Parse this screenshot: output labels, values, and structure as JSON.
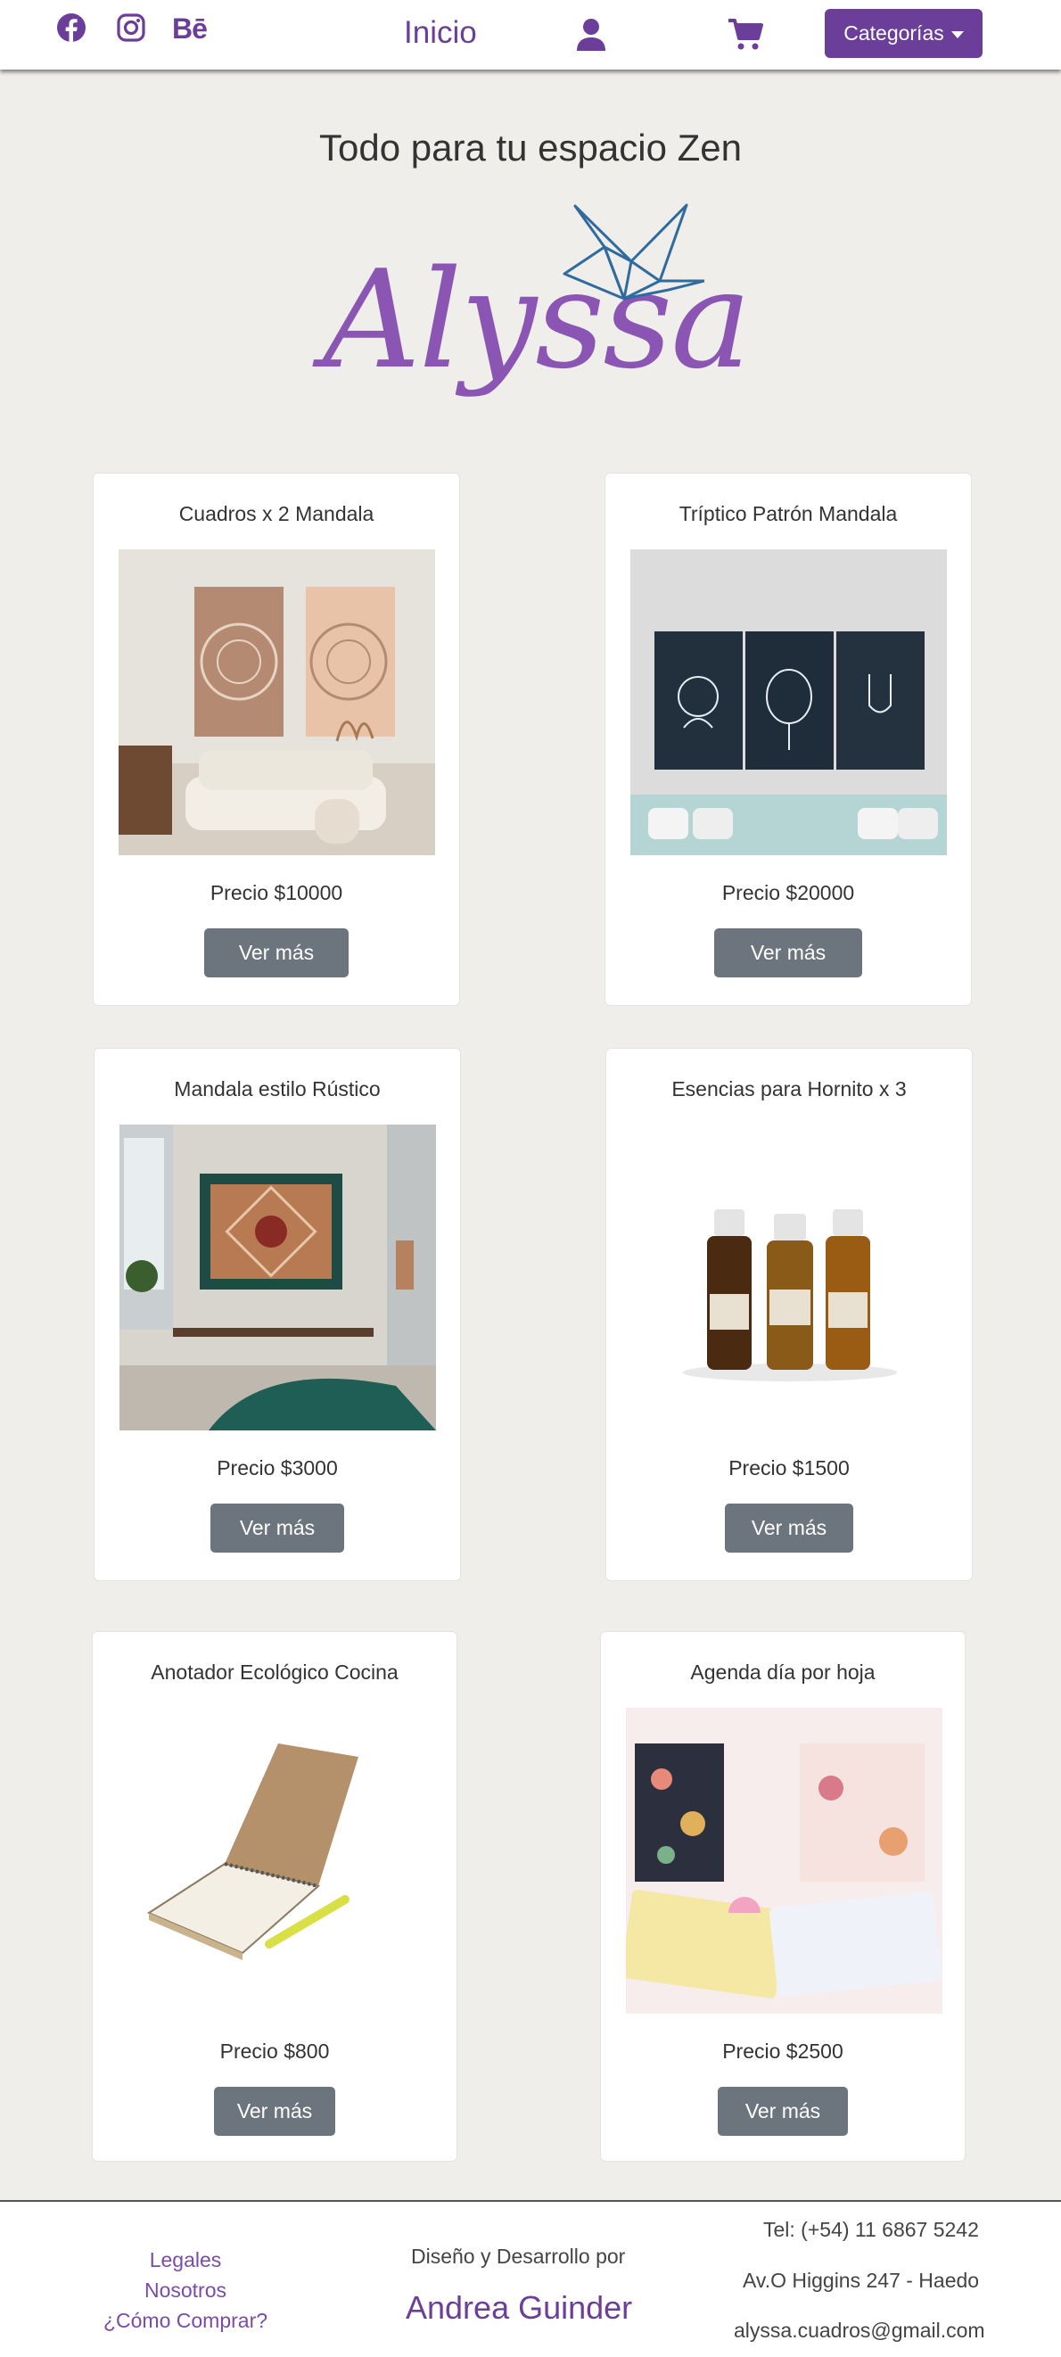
{
  "nav": {
    "inicio": "Inicio",
    "behance": "Bē",
    "dropdown": "Categorías",
    "icons": [
      "facebook-icon",
      "instagram-icon",
      "behance-icon",
      "user-icon",
      "cart-icon"
    ]
  },
  "hero": {
    "tagline": "Todo para tu espacio Zen",
    "logo_text": "Alyssa"
  },
  "products": [
    {
      "title": "Cuadros x 2 Mandala",
      "price": "Precio $10000",
      "button": "Ver más"
    },
    {
      "title": "Tríptico Patrón Mandala",
      "price": "Precio $20000",
      "button": "Ver más"
    },
    {
      "title": "Mandala estilo Rústico",
      "price": "Precio $3000",
      "button": "Ver más"
    },
    {
      "title": "Esencias para Hornito x 3",
      "price": "Precio $1500",
      "button": "Ver más"
    },
    {
      "title": "Anotador Ecológico Cocina",
      "price": "Precio $800",
      "button": "Ver más"
    },
    {
      "title": "Agenda día por hoja",
      "price": "Precio $2500",
      "button": "Ver más"
    }
  ],
  "footer": {
    "links": [
      "Legales",
      "Nosotros",
      "¿Cómo Comprar?"
    ],
    "credit": "Diseño y Desarrollo por",
    "author": "Andrea Guinder",
    "phone": "Tel: (+54) 11 6867 5242",
    "address": "Av.O Higgins 247 - Haedo",
    "email": "alyssa.cuadros@gmail.com"
  },
  "colors": {
    "brand": "#6b3e9a",
    "logo": "#8b56b3",
    "crane": "#2f6b9e",
    "button": "#6c757d",
    "background": "#efeeeb"
  }
}
